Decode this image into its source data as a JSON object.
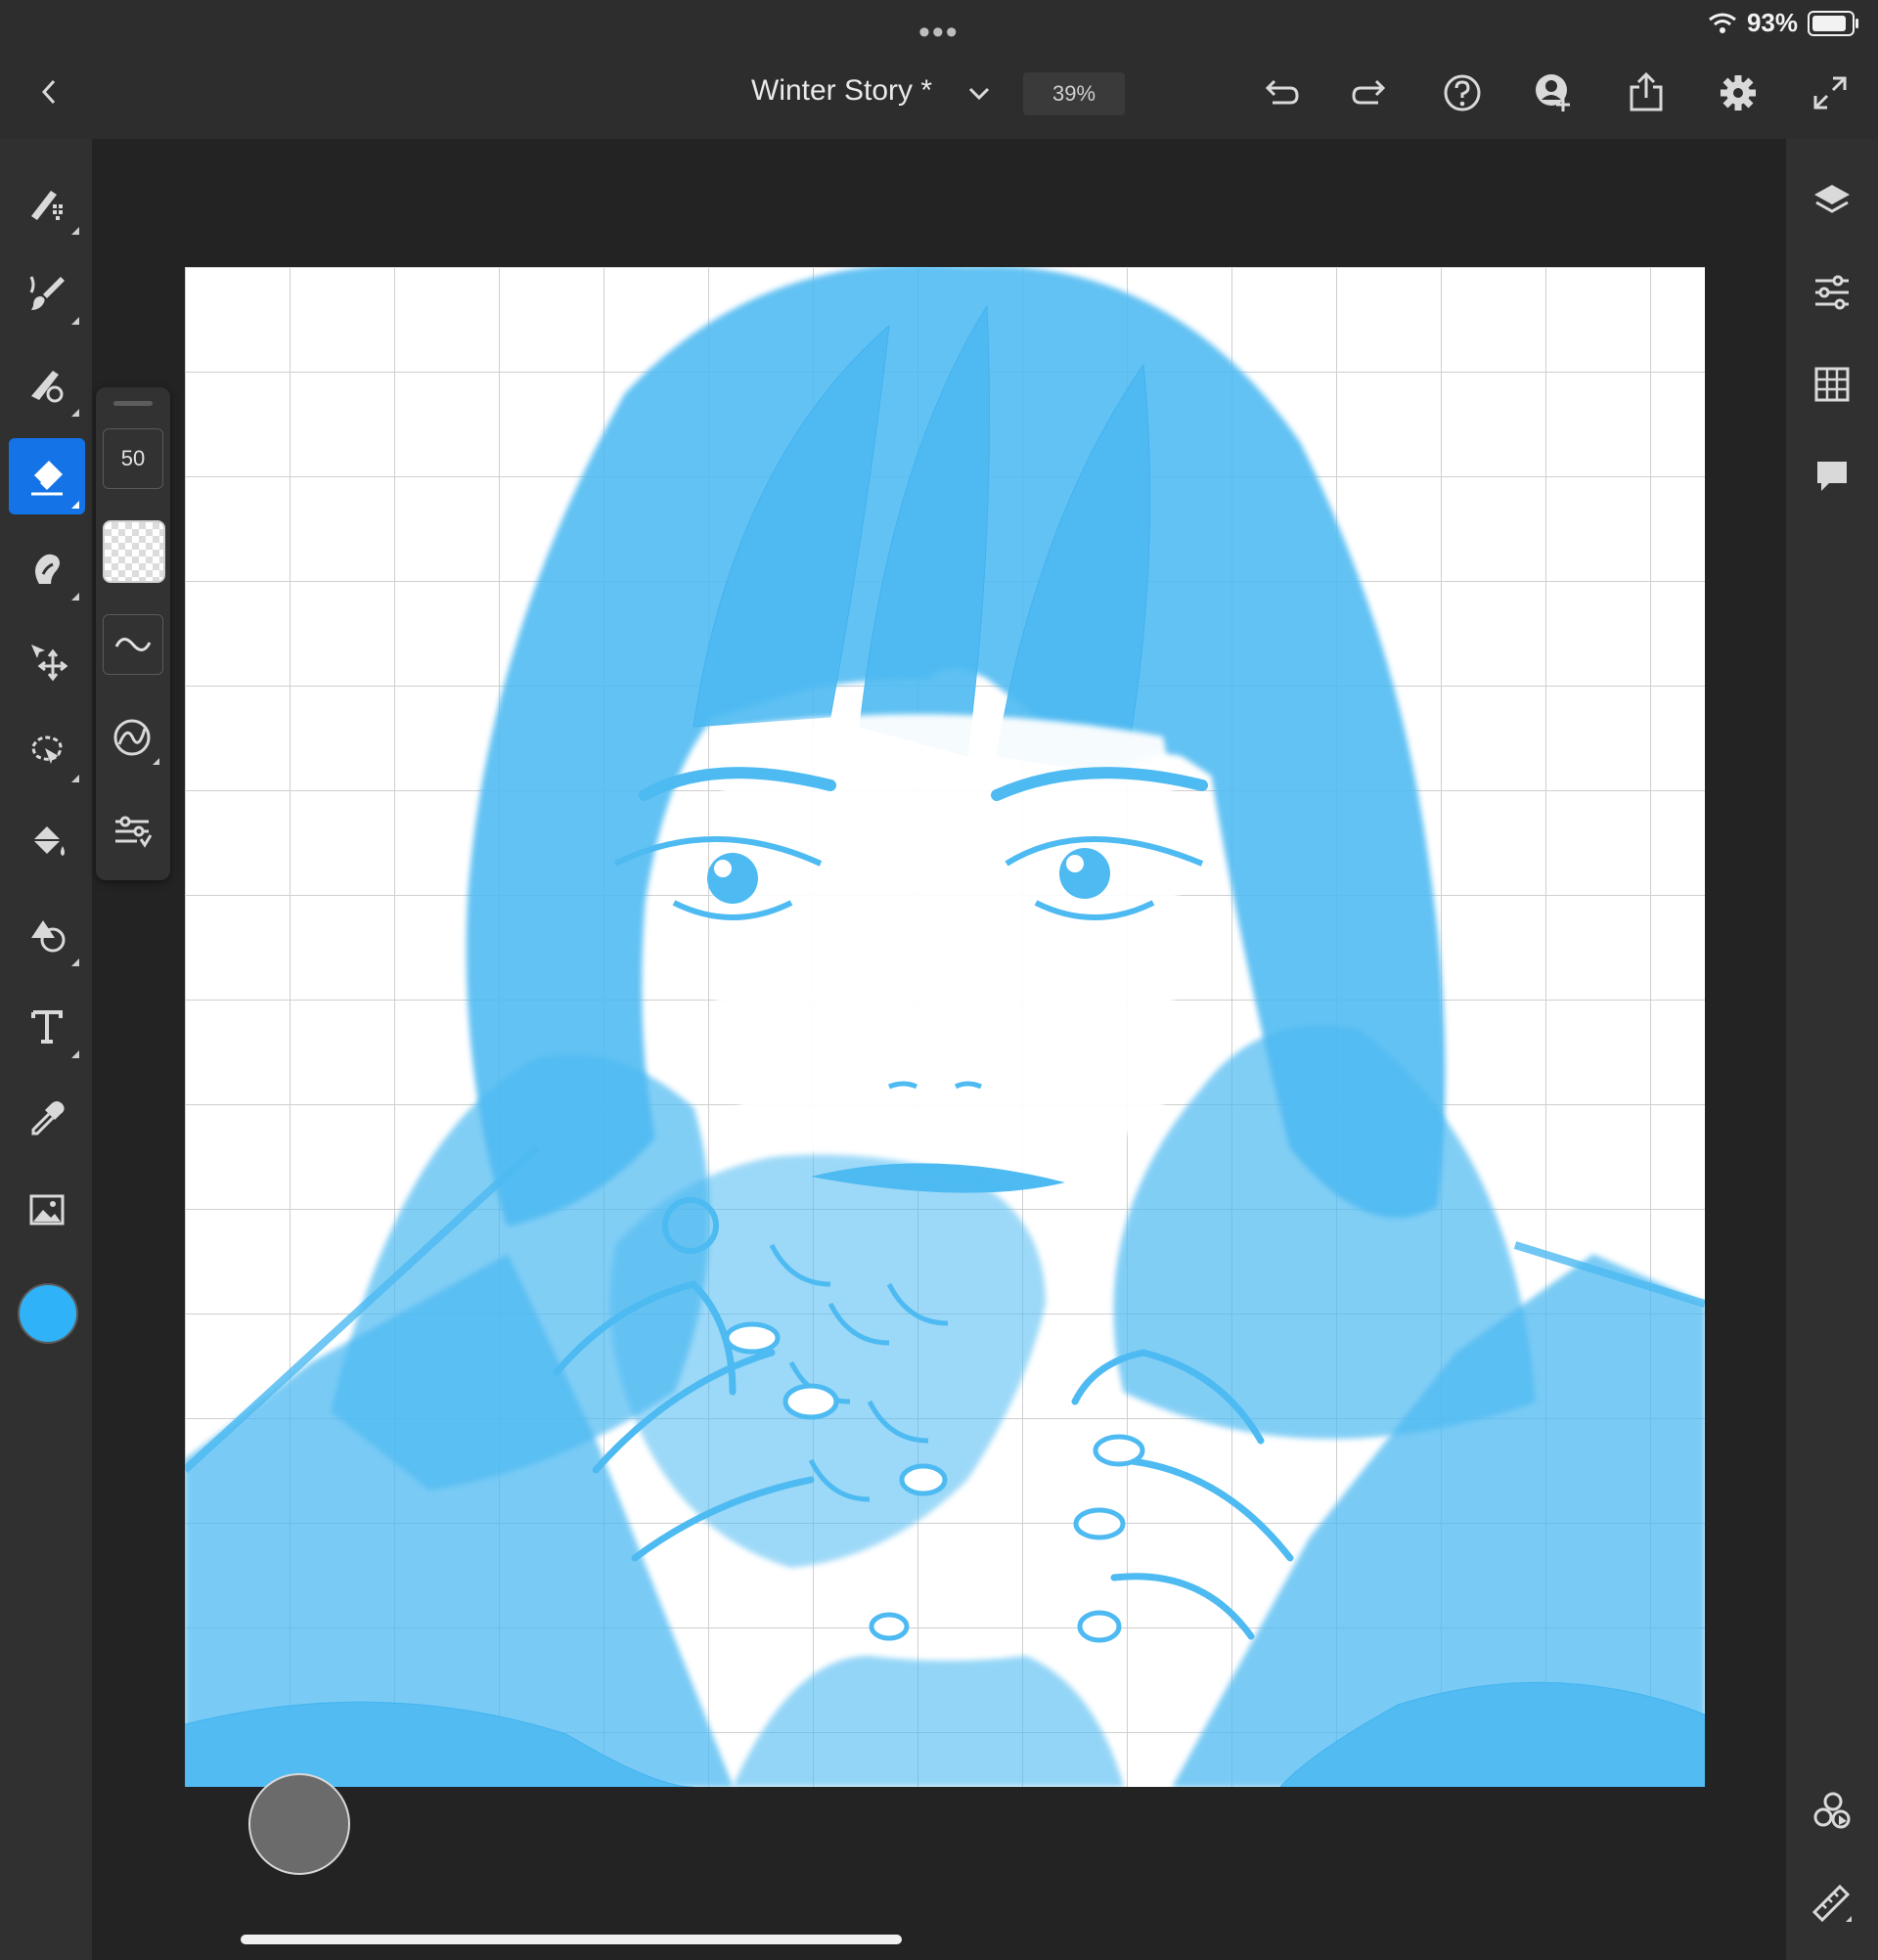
{
  "status_bar": {
    "battery": "93%"
  },
  "document": {
    "title": "Winter Story *",
    "zoom": "39%"
  },
  "brush_panel": {
    "size": "50"
  },
  "colors": {
    "accent": "#1473e6",
    "current_color": "#2fb2f7",
    "drawing": "#4dbaf2"
  },
  "icons": {
    "top": [
      "back-icon",
      "title-dropdown-icon",
      "undo-icon",
      "redo-icon",
      "help-icon",
      "invite-icon",
      "share-icon",
      "settings-icon",
      "fullscreen-icon"
    ],
    "left_tools": [
      "pixel-brush-icon",
      "live-brush-icon",
      "vector-brush-icon",
      "eraser-icon",
      "smudge-icon",
      "transform-icon",
      "selection-icon",
      "fill-icon",
      "shape-icon",
      "text-icon",
      "eyedropper-icon",
      "image-icon"
    ],
    "right_tools": [
      "layers-icon",
      "layer-properties-icon",
      "grid-icon",
      "comments-icon",
      "touch-shortcut-icon",
      "ruler-icon"
    ]
  }
}
